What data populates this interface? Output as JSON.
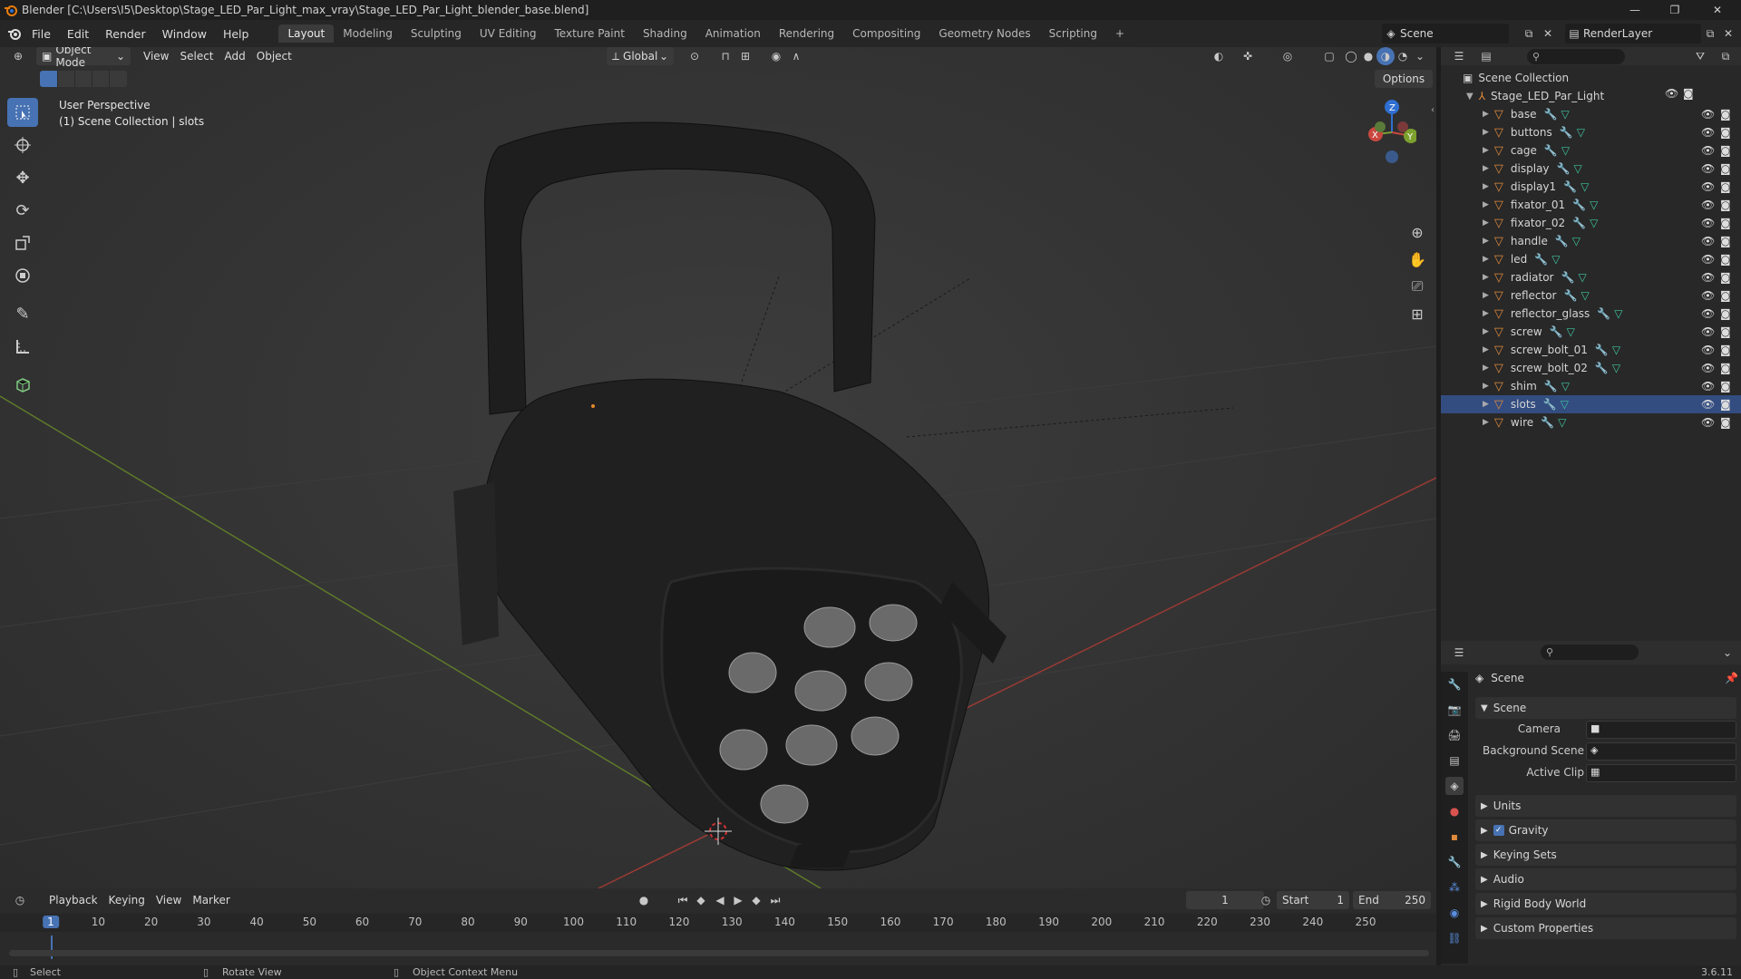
{
  "window": {
    "title": "Blender [C:\\Users\\I5\\Desktop\\Stage_LED_Par_Light_max_vray\\Stage_LED_Par_Light_blender_base.blend]",
    "minimize": "—",
    "maximize": "❐",
    "close": "✕"
  },
  "menus": [
    "File",
    "Edit",
    "Render",
    "Window",
    "Help"
  ],
  "workspaces": [
    "Layout",
    "Modeling",
    "Sculpting",
    "UV Editing",
    "Texture Paint",
    "Shading",
    "Animation",
    "Rendering",
    "Compositing",
    "Geometry Nodes",
    "Scripting"
  ],
  "workspace_add": "+",
  "scene_name": "Scene",
  "render_layer": "RenderLayer",
  "viewport_header": {
    "mode": "Object Mode",
    "menus": [
      "View",
      "Select",
      "Add",
      "Object"
    ],
    "transform_orientation": "Global",
    "options": "Options"
  },
  "viewport": {
    "perspective": "User Perspective",
    "collection_info": "(1) Scene Collection | slots",
    "gizmo_axes": {
      "x": "X",
      "y": "Y",
      "z": "Z"
    }
  },
  "tools": [
    "select-box",
    "cursor",
    "move",
    "rotate",
    "scale",
    "transform",
    "annotate",
    "measure",
    "add-cube"
  ],
  "outliner": {
    "root": "Scene Collection",
    "collection": "Stage_LED_Par_Light",
    "objects": [
      "base",
      "buttons",
      "cage",
      "display",
      "display1",
      "fixator_01",
      "fixator_02",
      "handle",
      "led",
      "radiator",
      "reflector",
      "reflector_glass",
      "screw",
      "screw_bolt_01",
      "screw_bolt_02",
      "shim",
      "slots",
      "wire"
    ],
    "selected": "slots"
  },
  "properties": {
    "context": "Scene",
    "panel_scene": "Scene",
    "camera_label": "Camera",
    "background_scene_label": "Background Scene",
    "active_clip_label": "Active Clip",
    "sections": [
      "Units",
      "Gravity",
      "Keying Sets",
      "Audio",
      "Rigid Body World",
      "Custom Properties"
    ],
    "gravity_checked": true
  },
  "timeline": {
    "menus": [
      "Playback",
      "Keying",
      "View",
      "Marker"
    ],
    "current_frame": "1",
    "start_label": "Start",
    "start": "1",
    "end_label": "End",
    "end": "250",
    "ruler": [
      "1",
      "10",
      "20",
      "30",
      "40",
      "50",
      "60",
      "70",
      "80",
      "90",
      "100",
      "110",
      "120",
      "130",
      "140",
      "150",
      "160",
      "170",
      "180",
      "190",
      "200",
      "210",
      "220",
      "230",
      "240",
      "250"
    ]
  },
  "statusbar": {
    "select": "Select",
    "rotate": "Rotate View",
    "context": "Object Context Menu",
    "version": "3.6.11"
  },
  "colors": {
    "accent": "#4772b3",
    "axis_x": "#c9473f",
    "axis_y": "#7ca02d",
    "axis_z": "#2f6fd1",
    "mesh_icon": "#e08a3c",
    "modifier_icon": "#5a8fe0",
    "data_icon": "#3fc5a0"
  }
}
